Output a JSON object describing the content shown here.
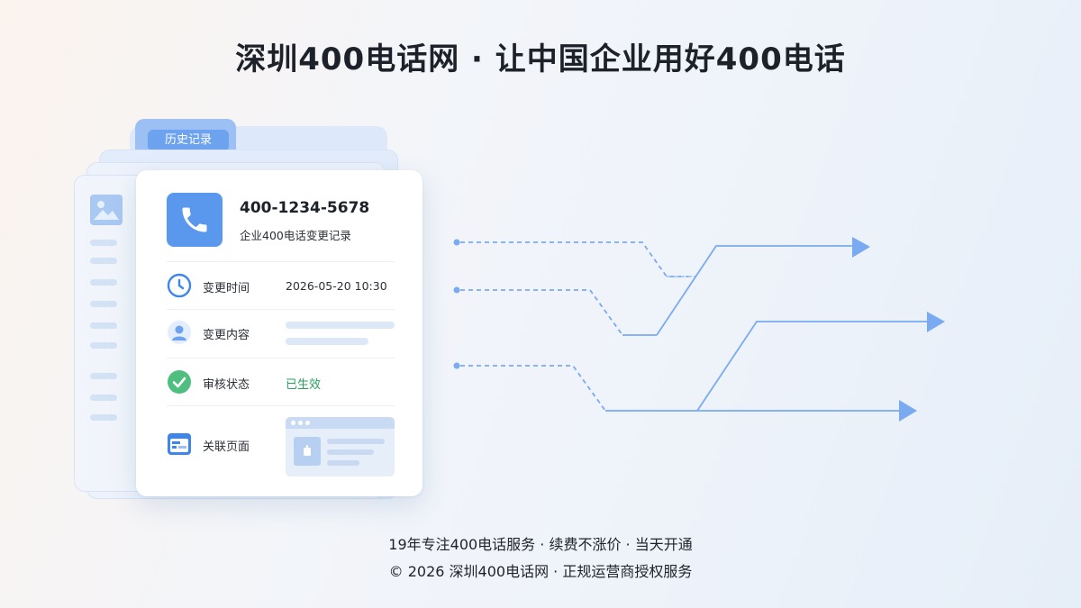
{
  "header": {
    "headline": "深圳400电话网 · 让中国企业用好400电话"
  },
  "folder": {
    "tab_label": "历史记录"
  },
  "record_card": {
    "phone_number": "400-1234-5678",
    "subtitle": "企业400电话变更记录",
    "rows": [
      {
        "icon": "clock-icon",
        "label": "变更时间",
        "value": "2026-05-20 10:30"
      },
      {
        "icon": "user-icon",
        "label": "变更内容"
      },
      {
        "icon": "check-circle-icon",
        "label": "审核状态",
        "value": "已生效"
      },
      {
        "icon": "browser-page-icon",
        "label": "关联页面"
      }
    ]
  },
  "colors": {
    "accent_blue": "#5a98ee",
    "status_green": "#2aa05b",
    "route_line": "#7aaaf0"
  },
  "footer": {
    "tagline": "19年专注400电话服务 · 续费不涨价 · 当天开通",
    "copyright": "© 2026 深圳400电话网 · 正规运营商授权服务"
  }
}
